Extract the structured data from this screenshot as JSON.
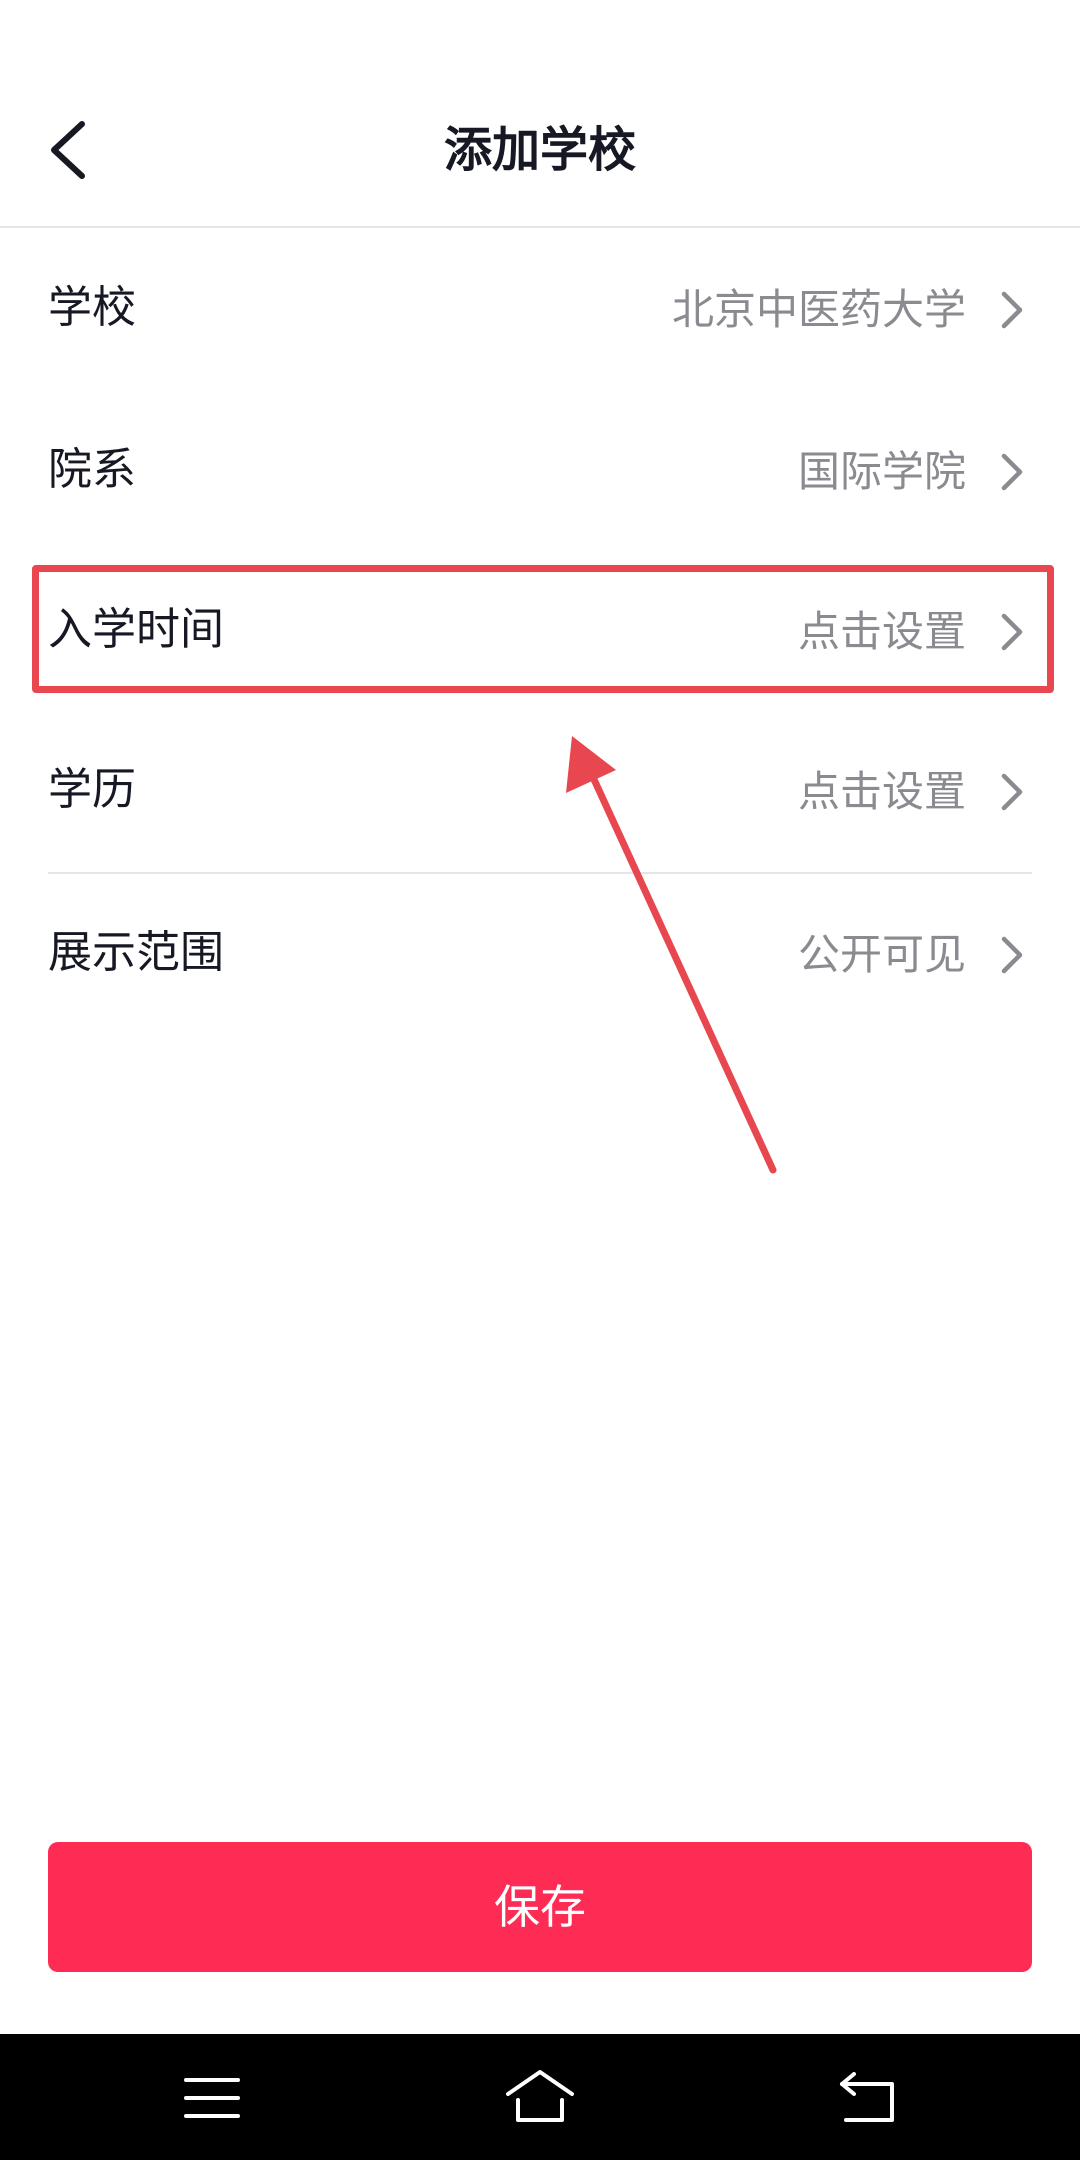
{
  "header": {
    "title": "添加学校"
  },
  "rows": [
    {
      "label": "学校",
      "value": "北京中医药大学"
    },
    {
      "label": "院系",
      "value": "国际学院"
    },
    {
      "label": "入学时间",
      "value": "点击设置"
    },
    {
      "label": "学历",
      "value": "点击设置"
    },
    {
      "label": "展示范围",
      "value": "公开可见"
    }
  ],
  "save_button": {
    "label": "保存"
  },
  "colors": {
    "accent": "#fe2c55",
    "annotation": "#e8474f",
    "text_primary": "#161823",
    "text_secondary": "#8a8b91"
  },
  "icons": {
    "back": "chevron-left-icon",
    "row": "chevron-right-icon",
    "nav_menu": "menu-icon",
    "nav_home": "home-icon",
    "nav_back": "back-icon"
  }
}
